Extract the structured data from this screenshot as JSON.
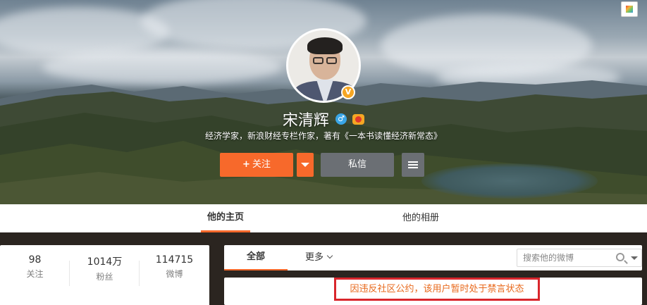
{
  "profile": {
    "name": "宋清辉",
    "bio": "经济学家，新浪财经专栏作家，著有《一本书读懂经济新常态》",
    "verified_badge": "V",
    "gender_icon": "male-icon",
    "vip_icon": "vip-icon"
  },
  "actions": {
    "follow_label": "关注",
    "message_label": "私信"
  },
  "tabs": [
    {
      "label": "他的主页",
      "active": true
    },
    {
      "label": "他的相册",
      "active": false
    }
  ],
  "stats": [
    {
      "value": "98",
      "label": "关注"
    },
    {
      "value": "1014万",
      "label": "粉丝"
    },
    {
      "value": "114715",
      "label": "微博"
    }
  ],
  "feed": {
    "tab_all": "全部",
    "tab_more": "更多",
    "search_placeholder": "搜索他的微博"
  },
  "notice": "因违反社区公约，该用户暂时处于禁言状态",
  "colors": {
    "accent": "#f7692b",
    "notice_border": "#d9262c",
    "notice_text": "#e8691c"
  }
}
